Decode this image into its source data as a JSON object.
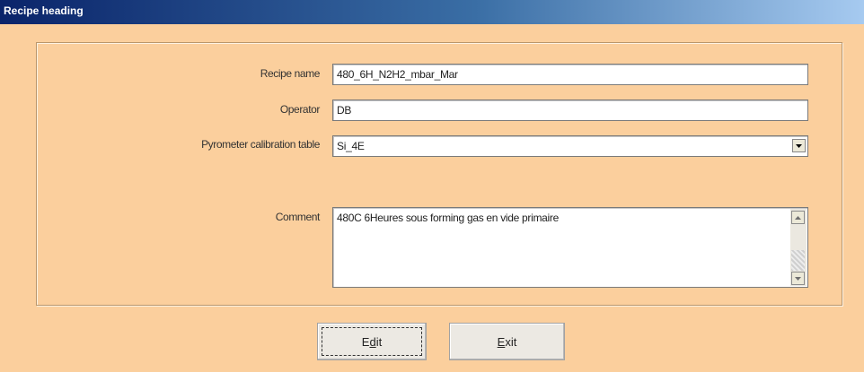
{
  "window": {
    "title": "Recipe heading"
  },
  "form": {
    "recipe_name_label": "Recipe name",
    "recipe_name_value": "480_6H_N2H2_mbar_Mar",
    "operator_label": "Operator",
    "operator_value": "DB",
    "pyrometer_label": "Pyrometer calibration table",
    "pyrometer_value": "Si_4E",
    "comment_label": "Comment",
    "comment_value": "480C 6Heures sous forming gas en vide primaire"
  },
  "buttons": {
    "edit": {
      "before": "E",
      "mnemonic": "d",
      "after": "it"
    },
    "exit": {
      "before": "",
      "mnemonic": "E",
      "after": "xit"
    }
  }
}
